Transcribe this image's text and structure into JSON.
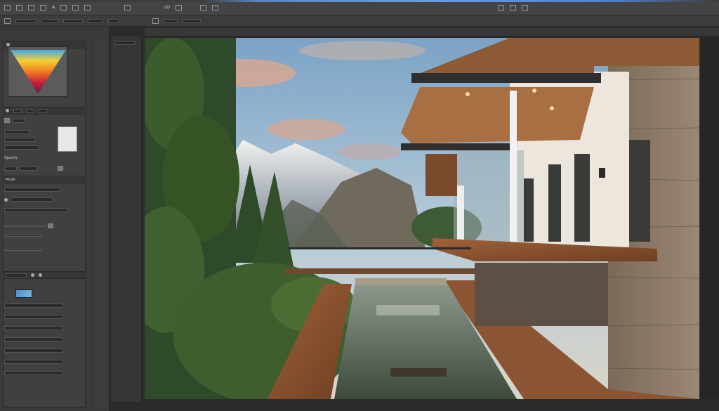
{
  "menubar": {
    "items": [
      "A",
      "",
      "",
      "",
      "",
      "",
      "",
      "LO",
      "",
      "",
      "",
      "",
      "",
      "",
      "",
      "",
      "",
      ""
    ],
    "right_items": [
      "",
      "",
      ""
    ]
  },
  "panels": {
    "layers_title": "",
    "blend_label": "Opacity",
    "section_label": "Mode"
  },
  "colors": {
    "sky_top": "#7da3c4",
    "sky_bottom": "#b9cfdc",
    "accent_blue": "#5a86c9"
  }
}
